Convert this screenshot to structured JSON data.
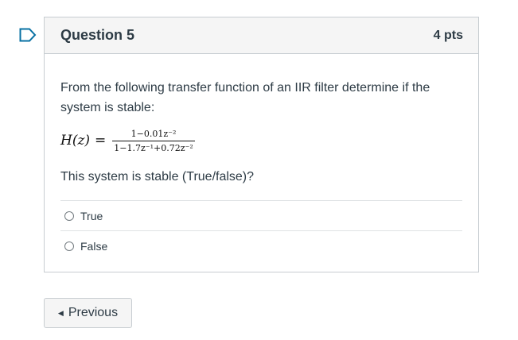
{
  "question": {
    "title": "Question 5",
    "points": "4 pts",
    "text": "From the following transfer function of an IIR filter determine if the system is stable:",
    "formula": {
      "lhs": "H(z)",
      "equals": "=",
      "numerator": "1−0.01z⁻²",
      "denominator": "1−1.7z⁻¹+0.72z⁻²"
    },
    "prompt": "This system is stable (True/false)?",
    "options": [
      {
        "label": "True"
      },
      {
        "label": "False"
      }
    ]
  },
  "navigation": {
    "previous_label": "Previous",
    "previous_icon": "caret-left-icon"
  },
  "colors": {
    "flag_outline": "#0770a3",
    "border": "#c7cdd1",
    "header_bg": "#f5f5f5",
    "text": "#2d3b45"
  }
}
